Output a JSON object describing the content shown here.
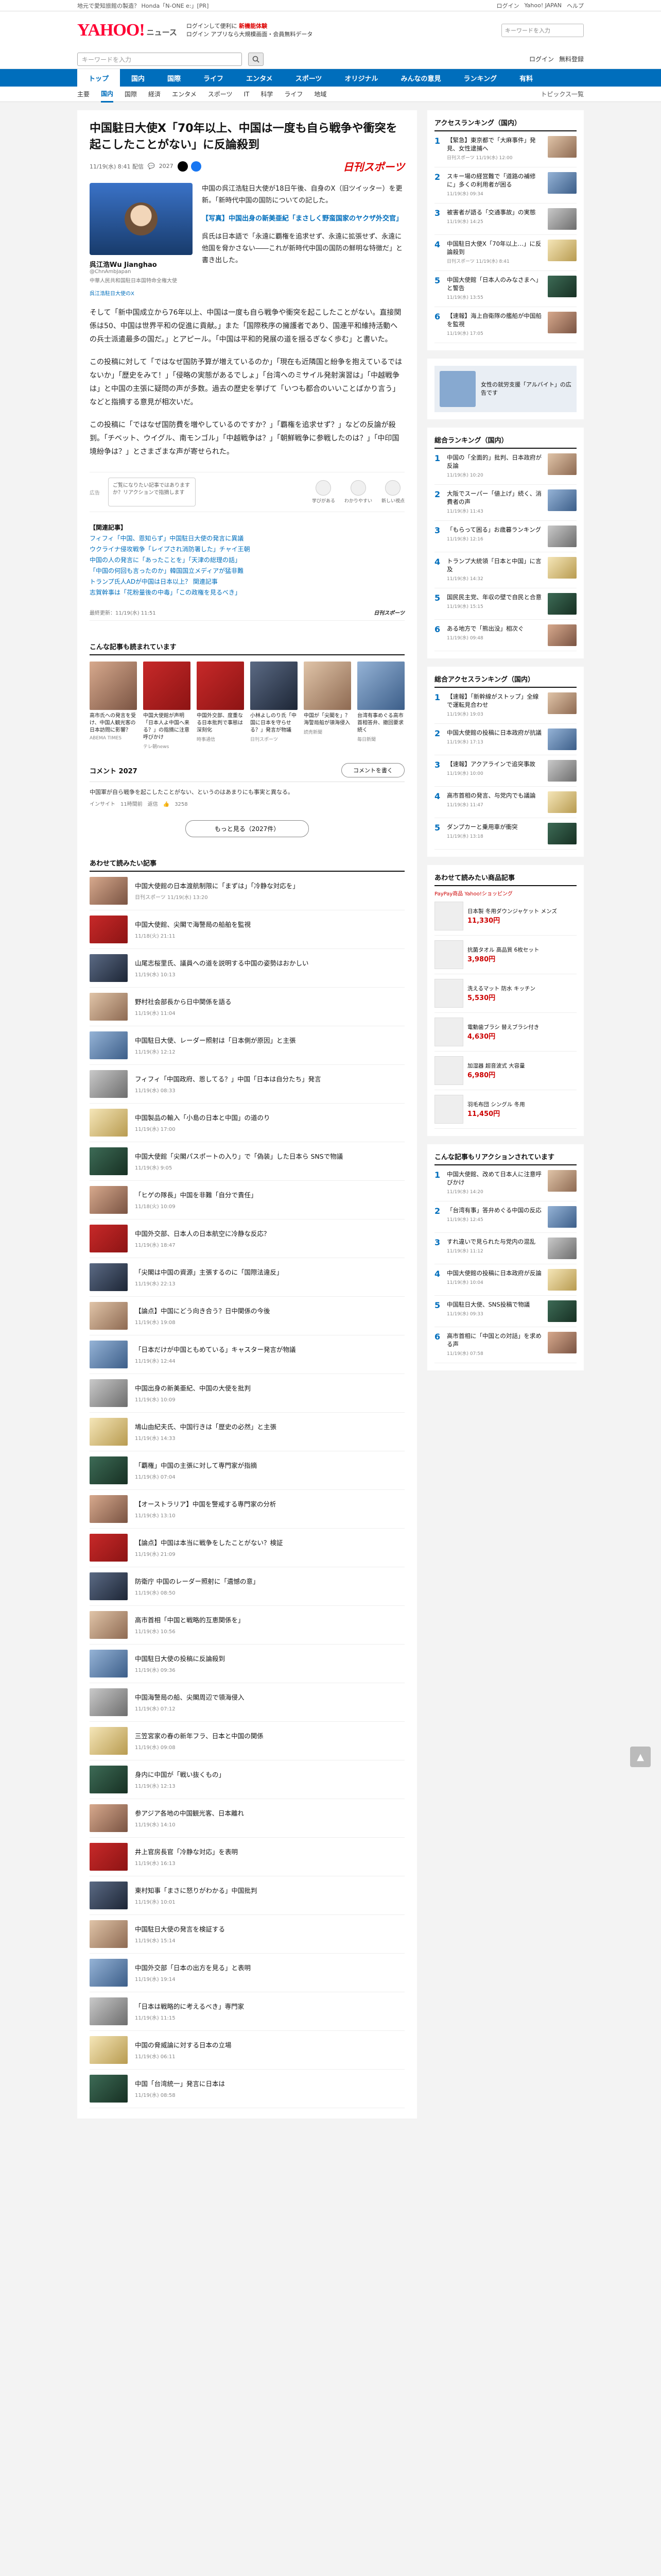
{
  "topbar": {
    "left": "地元で愛知旅館の製造？ Honda「N-ONE e:」[PR]",
    "links": [
      "ログイン",
      "Yahoo! JAPAN",
      "ヘルプ"
    ]
  },
  "header": {
    "logo": "YAHOO!",
    "logo_sub": "ニュース",
    "notice": "ログインして便利に",
    "notice_b": "新機能体験",
    "sub": "ログイン  アプリなら大規模画面・会員無料データ",
    "search_ph": "キーワードを入力"
  },
  "search": {
    "placeholder": "キーワードを入力",
    "right": [
      "ログイン",
      "無料登録"
    ]
  },
  "cats": [
    "トップ",
    "国内",
    "国際",
    "ライフ",
    "エンタメ",
    "スポーツ",
    "オリジナル",
    "みんなの意見",
    "ランキング",
    "有料"
  ],
  "subcats": [
    "主要",
    "国内",
    "国際",
    "経済",
    "エンタメ",
    "スポーツ",
    "IT",
    "科学",
    "ライフ",
    "地域"
  ],
  "subcats_right": "トピックス一覧",
  "article": {
    "title": "中国駐日大使X「70年以上、中国は一度も自ら戦争や衝突を起こしたことがない」に反論殺到",
    "date": "11/19(水) 8:41 配信",
    "comments": "2027",
    "source": "日刊スポーツ",
    "tw_name": "呉江浩Wu Jianghao",
    "tw_id": "@ChnAmbJapan",
    "tw_sub": "中華人民共和国駐日本国特命全権大使",
    "tw_cap": "呉江浩駐日大使のX",
    "lead_cap": "【写真】中国出身の新美亜紀「まさしく野蛮国家のヤクザ外交官」",
    "lead": "中国の呉江浩駐日大使が18日午後、自身のX（旧ツイッター）を更新。「新時代中国の国防についての記した。",
    "lead2": "呉氏は日本語で「永遠に覇権を追求せず、永遠に拡張せず、永遠に他国を脅かさない――これが新時代中国の国防の鮮明な特徴だ」と書き出した。",
    "p1": "そして「新中国成立から76年以上、中国は一度も自ら戦争や衝突を起こしたことがない。直接関係は50、中国は世界平和の促進に貢献。」また「国際秩序の擁護者であり、国連平和維持活動への兵士派遣最多の国だ。」とアピール。「中国は平和的発展の道を揺るぎなく歩む」と書いた。",
    "p2": "この投稿に対して「ではなぜ国防予算が増えているのか」「現在も近隣国と紛争を抱えているではないか」「歴史をみて！」「侵略の実態があるでしょ」「台湾へのミサイル発射演習は」「中越戦争は」と中国の主張に疑問の声が多数。過去の歴史を挙げて「いつも都合のいいことばかり言う」などと指摘する意見が相次いだ。",
    "p3": "この投稿に「ではなぜ国防費を増やしているのですか？」「覇権を追求せず？」などの反論が殺到。「チベット、ウイグル、南モンゴル」「中越戦争は？」「朝鮮戦争に参戦したのは？」「中印国境紛争は？」とさまざまな声が寄せられた。",
    "adlabel": "広告",
    "ad": "ご覧になりたい記事ではありますか？リアクションで指摘します",
    "reacts": [
      "学びがある",
      "わかりやすい",
      "新しい視点"
    ],
    "related_ttl": "【関連記事】",
    "related": [
      "フィフィ「中国、恩知らず」中国駐日大使の発言に異議",
      "ウクライナ侵攻戦争「レイプされ消防署した」チャイ王朝",
      "中国の人の発言に「あったことを」「天津の総理の話」",
      "「中国の何回も言ったのか」韓国国立メディアが猛非難",
      "トランプ氏人ADが中国は日本以上？ 関連記事",
      "志賀幹事は「花粉量後の中毒」「この政権を見るべき」"
    ],
    "src_line": "最終更新：11/19(水) 11:51",
    "src_name": "日刊スポーツ"
  },
  "reads": {
    "title": "こんな記事も読まれています",
    "items": [
      {
        "t": "高市氏への発言を受け、中国人観光客の日本訪問に影響？",
        "s": "ABEMA TIMES"
      },
      {
        "t": "中国大使館が声明「日本人よ中国へ来る？」の指摘に注意呼びかけ",
        "s": "テレ朝news"
      },
      {
        "t": "中国外交部、度重なる日本批判で事態は深刻化",
        "s": "時事通信"
      },
      {
        "t": "小林よしのり氏「中国に日本を守らせる？」発言が物議",
        "s": "日刊スポーツ"
      },
      {
        "t": "中国が「尖閣を」？海警局船が領海侵入",
        "s": "読売新聞"
      },
      {
        "t": "台湾有事めぐる高市首相答弁、撤回要求続く",
        "s": "毎日新聞"
      }
    ]
  },
  "comments": {
    "label": "コメント",
    "count": "2027",
    "btn": "コメントを書く",
    "first": "中国軍が自ら戦争を起こしたことがない、というのはあまりにも事実と異なる。",
    "first_user": "インサイト",
    "first_time": "11時間前",
    "reply": "返信",
    "likes": "3258",
    "more": "もっと見る（2027件）"
  },
  "recommend": {
    "title": "あわせて読みたい記事",
    "items": [
      {
        "t": "中国大使館の日本渡航制限に「まずは」「冷静な対応を」",
        "s": "日刊スポーツ  11/19(水) 13:20"
      },
      {
        "t": "中国大使館、尖閣で海警局の船舶を監視",
        "s": "11/18(火) 21:11"
      },
      {
        "t": "山尾志桜里氏、議員への道を説明する中国の姿勢はおかしい",
        "s": "11/19(水) 10:13"
      },
      {
        "t": "野村社会部長から日中関係を語る",
        "s": "11/19(水) 11:04"
      },
      {
        "t": "中国駐日大使、レーダー照射は「日本側が原因」と主張",
        "s": "11/19(水) 12:12"
      },
      {
        "t": "フィフィ「中国政府、恩してる？」中国「日本は自分たち」発言",
        "s": "11/19(水) 08:33"
      },
      {
        "t": "中国製品の輸入「小島の日本と中国」の道のり",
        "s": "11/19(水) 17:00"
      },
      {
        "t": "中国大使館「尖閣パスポートの入り」で「偽装」した日本ら SNSで物議",
        "s": "11/19(水) 9:05"
      },
      {
        "t": "「ヒゲの隊長」中国を非難「自分で責任」",
        "s": "11/18(火) 10:09"
      },
      {
        "t": "中国外交部、日本人の日本航空に冷静な反応？",
        "s": "11/19(水) 18:47"
      },
      {
        "t": "「尖閣は中国の資源」主張するのに「国際法違反」",
        "s": "11/19(水) 22:13"
      },
      {
        "t": "【論点】中国にどう向き合う？日中関係の今後",
        "s": "11/19(水) 19:08"
      },
      {
        "t": "「日本だけが中国ともめている」キャスター発言が物議",
        "s": "11/19(水) 12:44"
      },
      {
        "t": "中国出身の新美亜紀、中国の大使を批判",
        "s": "11/19(水) 10:09"
      },
      {
        "t": "鳩山由紀夫氏、中国行きは「歴史の必然」と主張",
        "s": "11/19(水) 14:33"
      },
      {
        "t": "「覇権」中国の主張に対して専門家が指摘",
        "s": "11/19(水) 07:04"
      },
      {
        "t": "【オーストラリア】中国を警戒する専門家の分析",
        "s": "11/19(水) 13:10"
      },
      {
        "t": "【論点】中国は本当に戦争をしたことがない？検証",
        "s": "11/19(水) 21:09"
      },
      {
        "t": "防衛庁 中国のレーダー照射に「遺憾の意」",
        "s": "11/19(水) 08:50"
      },
      {
        "t": "高市首相「中国と戦略的互恵関係を」",
        "s": "11/19(水) 10:56"
      },
      {
        "t": "中国駐日大使の投稿に反論殺到",
        "s": "11/19(水) 09:36"
      },
      {
        "t": "中国海警局の船、尖閣周辺で領海侵入",
        "s": "11/19(水) 07:12"
      },
      {
        "t": "三笠宮家の春の新年フラ、日本と中国の関係",
        "s": "11/19(水) 09:08"
      },
      {
        "t": "身内に中国が「戦い抜くもの」",
        "s": "11/19(水) 12:13"
      },
      {
        "t": "参アジア各地の中国観光客、日本離れ",
        "s": "11/19(水) 14:10"
      },
      {
        "t": "井上官房長官「冷静な対応」を表明",
        "s": "11/19(水) 16:13"
      },
      {
        "t": "東村知事「まさに怒りがわかる」中国批判",
        "s": "11/19(水) 10:01"
      },
      {
        "t": "中国駐日大使の発言を検証する",
        "s": "11/19(水) 15:14"
      },
      {
        "t": "中国外交部「日本の出方を見る」と表明",
        "s": "11/19(水) 19:14"
      },
      {
        "t": "「日本は戦略的に考えるべき」専門家",
        "s": "11/19(水) 11:15"
      },
      {
        "t": "中国の脅威論に対する日本の立場",
        "s": "11/19(水) 06:11"
      },
      {
        "t": "中国「台湾統一」発言に日本は",
        "s": "11/19(水) 08:58"
      }
    ]
  },
  "side": {
    "ranking_title": "アクセスランキング（国内）",
    "ranking": [
      {
        "t": "【緊急】東京都で「大麻事件」発見、女性逮捕へ",
        "s": "日刊スポーツ 11/19(水) 12:00"
      },
      {
        "t": "スキー場の経営難で「道路の補修に」多くの利用者が困る",
        "s": "11/19(水) 09:34"
      },
      {
        "t": "被害者が語る「交通事故」の実態",
        "s": "11/19(水) 14:25"
      },
      {
        "t": "中国駐日大使X「70年以上…」に反論殺到",
        "s": "日刊スポーツ 11/19(水) 8:41"
      },
      {
        "t": "中国大使館「日本人のみなさまへ」と警告",
        "s": "11/19(水) 13:55"
      },
      {
        "t": "【速報】海上自衛隊の艦船が中国船を監視",
        "s": "11/19(水) 17:05"
      }
    ],
    "ad_text": "女性の就労支援「アルバイト」の広告です",
    "ranking2_title": "総合ランキング（国内）",
    "ranking2": [
      {
        "t": "中国の「全面的」批判、日本政府が反論",
        "s": "11/19(水) 10:20"
      },
      {
        "t": "大阪でスーパー「値上げ」続く、消費者の声",
        "s": "11/19(水) 11:43"
      },
      {
        "t": "「もらって困る」お歳暮ランキング",
        "s": "11/19(水) 12:16"
      },
      {
        "t": "トランプ大統領「日本と中国」に言及",
        "s": "11/19(水) 14:32"
      },
      {
        "t": "国民民主党、年収の壁で自民と合意",
        "s": "11/19(水) 15:15"
      },
      {
        "t": "ある地方で「熊出没」相次ぐ",
        "s": "11/19(水) 09:48"
      }
    ],
    "rank3_title": "総合アクセスランキング（国内）",
    "rank3": [
      {
        "t": "【速報】「新幹線がストップ」全線で運転見合わせ",
        "s": "11/19(水) 19:03"
      },
      {
        "t": "中国大使館の投稿に日本政府が抗議",
        "s": "11/19(水) 17:13"
      },
      {
        "t": "【速報】アクアラインで追突事故",
        "s": "11/19(水) 10:00"
      },
      {
        "t": "高市首相の発言、与党内でも議論",
        "s": "11/19(水) 11:47"
      },
      {
        "t": "ダンプカーと乗用車が衝突",
        "s": "11/19(水) 13:18"
      }
    ],
    "shop_title": "あわせて読みたい商品記事",
    "shop_sub": "PayPay商品 Yahoo!ショッピング",
    "shop": [
      {
        "t": "日本製 冬用ダウンジャケット メンズ",
        "p": "11,330円"
      },
      {
        "t": "抗菌タオル 高品質 6枚セット",
        "p": "3,980円"
      },
      {
        "t": "洗えるマット 防水 キッチン",
        "p": "5,530円"
      },
      {
        "t": "電動歯ブラシ 替えブラシ付き",
        "p": "4,630円"
      },
      {
        "t": "加湿器 超音波式 大容量",
        "p": "6,980円"
      },
      {
        "t": "羽毛布団 シングル 冬用",
        "p": "11,450円"
      }
    ],
    "rec_title": "こんな記事もリアクションされています",
    "rec": [
      {
        "t": "中国大使館、改めて日本人に注意呼びかけ",
        "s": "11/19(水) 14:20"
      },
      {
        "t": "「台湾有事」答弁めぐる中国の反応",
        "s": "11/19(水) 12:45"
      },
      {
        "t": "すれ違いで見られた与党内の混乱",
        "s": "11/19(水) 11:12"
      },
      {
        "t": "中国大使館の投稿に日本政府が反論",
        "s": "11/19(水) 10:04"
      },
      {
        "t": "中国駐日大使、SNS投稿で物議",
        "s": "11/19(水) 09:33"
      },
      {
        "t": "高市首相に「中国との対話」を求める声",
        "s": "11/19(水) 07:58"
      }
    ]
  }
}
